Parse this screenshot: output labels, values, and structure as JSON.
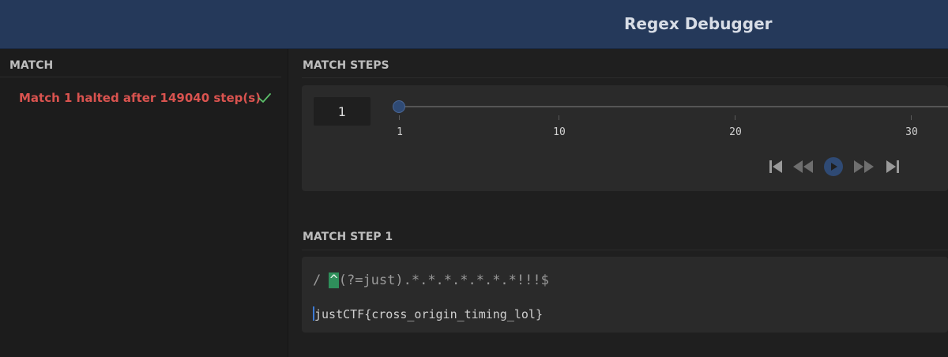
{
  "header": {
    "title": "Regex Debugger",
    "background": "#25395a"
  },
  "left": {
    "heading": "MATCH",
    "matches": [
      {
        "label": "Match 1 halted after 149040 step(s)",
        "status": "check-icon",
        "color": "#d9534f"
      }
    ]
  },
  "steps": {
    "heading": "MATCH STEPS",
    "current_step": "1",
    "slider": {
      "value": 1,
      "ticks": [
        "1",
        "10",
        "20",
        "30"
      ]
    },
    "controls": [
      "skip-to-start-icon",
      "rewind-icon",
      "play-icon",
      "fast-forward-icon",
      "skip-to-end-icon"
    ]
  },
  "step_view": {
    "heading": "MATCH STEP 1",
    "regex_prefix": "/ ",
    "regex_highlight": "^",
    "regex_rest": "(?=just).*.*.*.*.*.*.*!!!$",
    "subject": "justCTF{cross_origin_timing_lol}",
    "highlight_color": "#2f8f5b"
  }
}
